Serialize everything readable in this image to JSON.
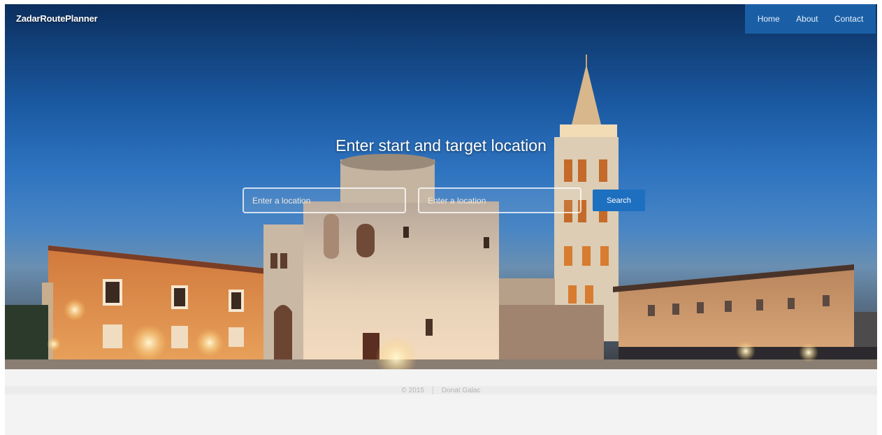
{
  "brand": {
    "title": "ZadarRoutePlanner"
  },
  "nav": {
    "items": [
      {
        "label": "Home"
      },
      {
        "label": "About"
      },
      {
        "label": "Contact"
      }
    ]
  },
  "hero": {
    "heading": "Enter start and target location",
    "start_input": {
      "placeholder": "Enter a location",
      "value": ""
    },
    "target_input": {
      "placeholder": "Enter a location",
      "value": ""
    },
    "search_label": "Search"
  },
  "footer": {
    "copyright": "© 2015",
    "author": "Donat Galac"
  },
  "colors": {
    "accent": "#1a5fa6",
    "search_button": "#1d6fc0",
    "footer_bg": "#f3f3f3"
  }
}
